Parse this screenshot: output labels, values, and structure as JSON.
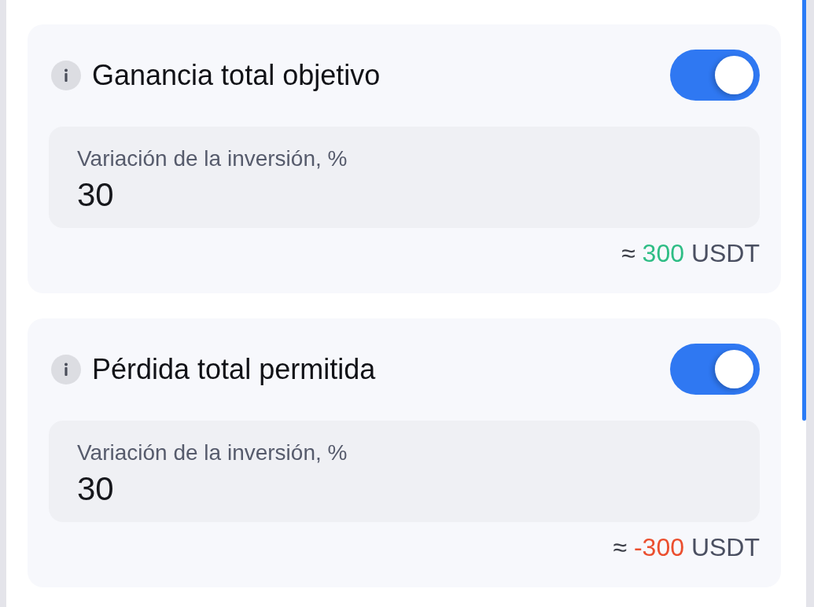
{
  "cards": [
    {
      "title": "Ganancia total objetivo",
      "toggle": {
        "on": true
      },
      "field": {
        "label": "Variación de la inversión, %",
        "value": "30"
      },
      "estimate": {
        "prefix": "≈",
        "amount": "300",
        "currency": "USDT",
        "color": "#2ebd85"
      }
    },
    {
      "title": "Pérdida total permitida",
      "toggle": {
        "on": true
      },
      "field": {
        "label": "Variación de la inversión, %",
        "value": "30"
      },
      "estimate": {
        "prefix": "≈",
        "amount": "-300",
        "currency": "USDT",
        "color": "#eb4f2f"
      }
    }
  ]
}
